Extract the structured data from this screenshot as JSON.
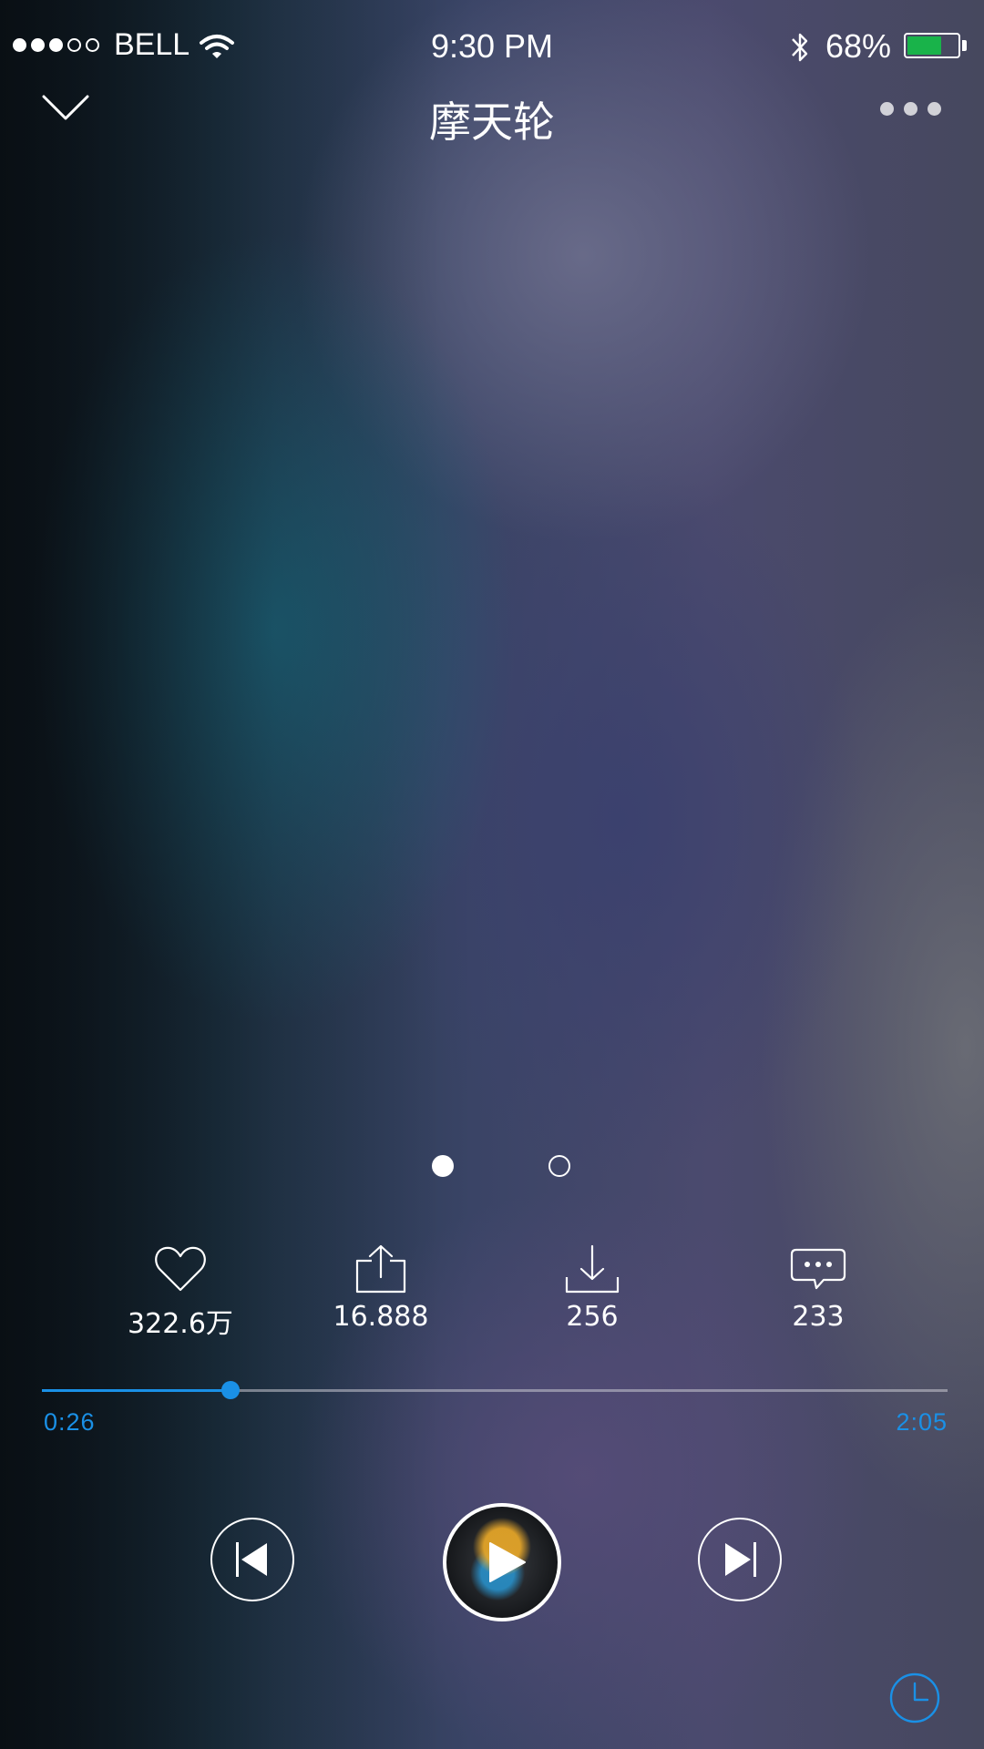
{
  "status_bar": {
    "carrier": "BELL",
    "signal_bars_filled": 3,
    "signal_bars_total": 5,
    "time": "9:30 PM",
    "battery_percent": "68%",
    "battery_level": 0.68,
    "battery_color": "#19b34a"
  },
  "header": {
    "title": "摩天轮"
  },
  "pager": {
    "pages": 2,
    "current": 1
  },
  "actions": [
    {
      "name": "like",
      "icon": "heart-icon",
      "count": "322.6万"
    },
    {
      "name": "share",
      "icon": "share-icon",
      "count": "16.888"
    },
    {
      "name": "download",
      "icon": "download-icon",
      "count": "256"
    },
    {
      "name": "comment",
      "icon": "comment-icon",
      "count": "233"
    }
  ],
  "playback": {
    "current_time": "0:26",
    "total_time": "2:05",
    "progress_fraction": 0.208,
    "accent_color": "#1a90e6"
  },
  "controls": {
    "previous": "previous-icon",
    "play": "play-icon",
    "next": "next-icon",
    "timer": "clock-icon"
  }
}
